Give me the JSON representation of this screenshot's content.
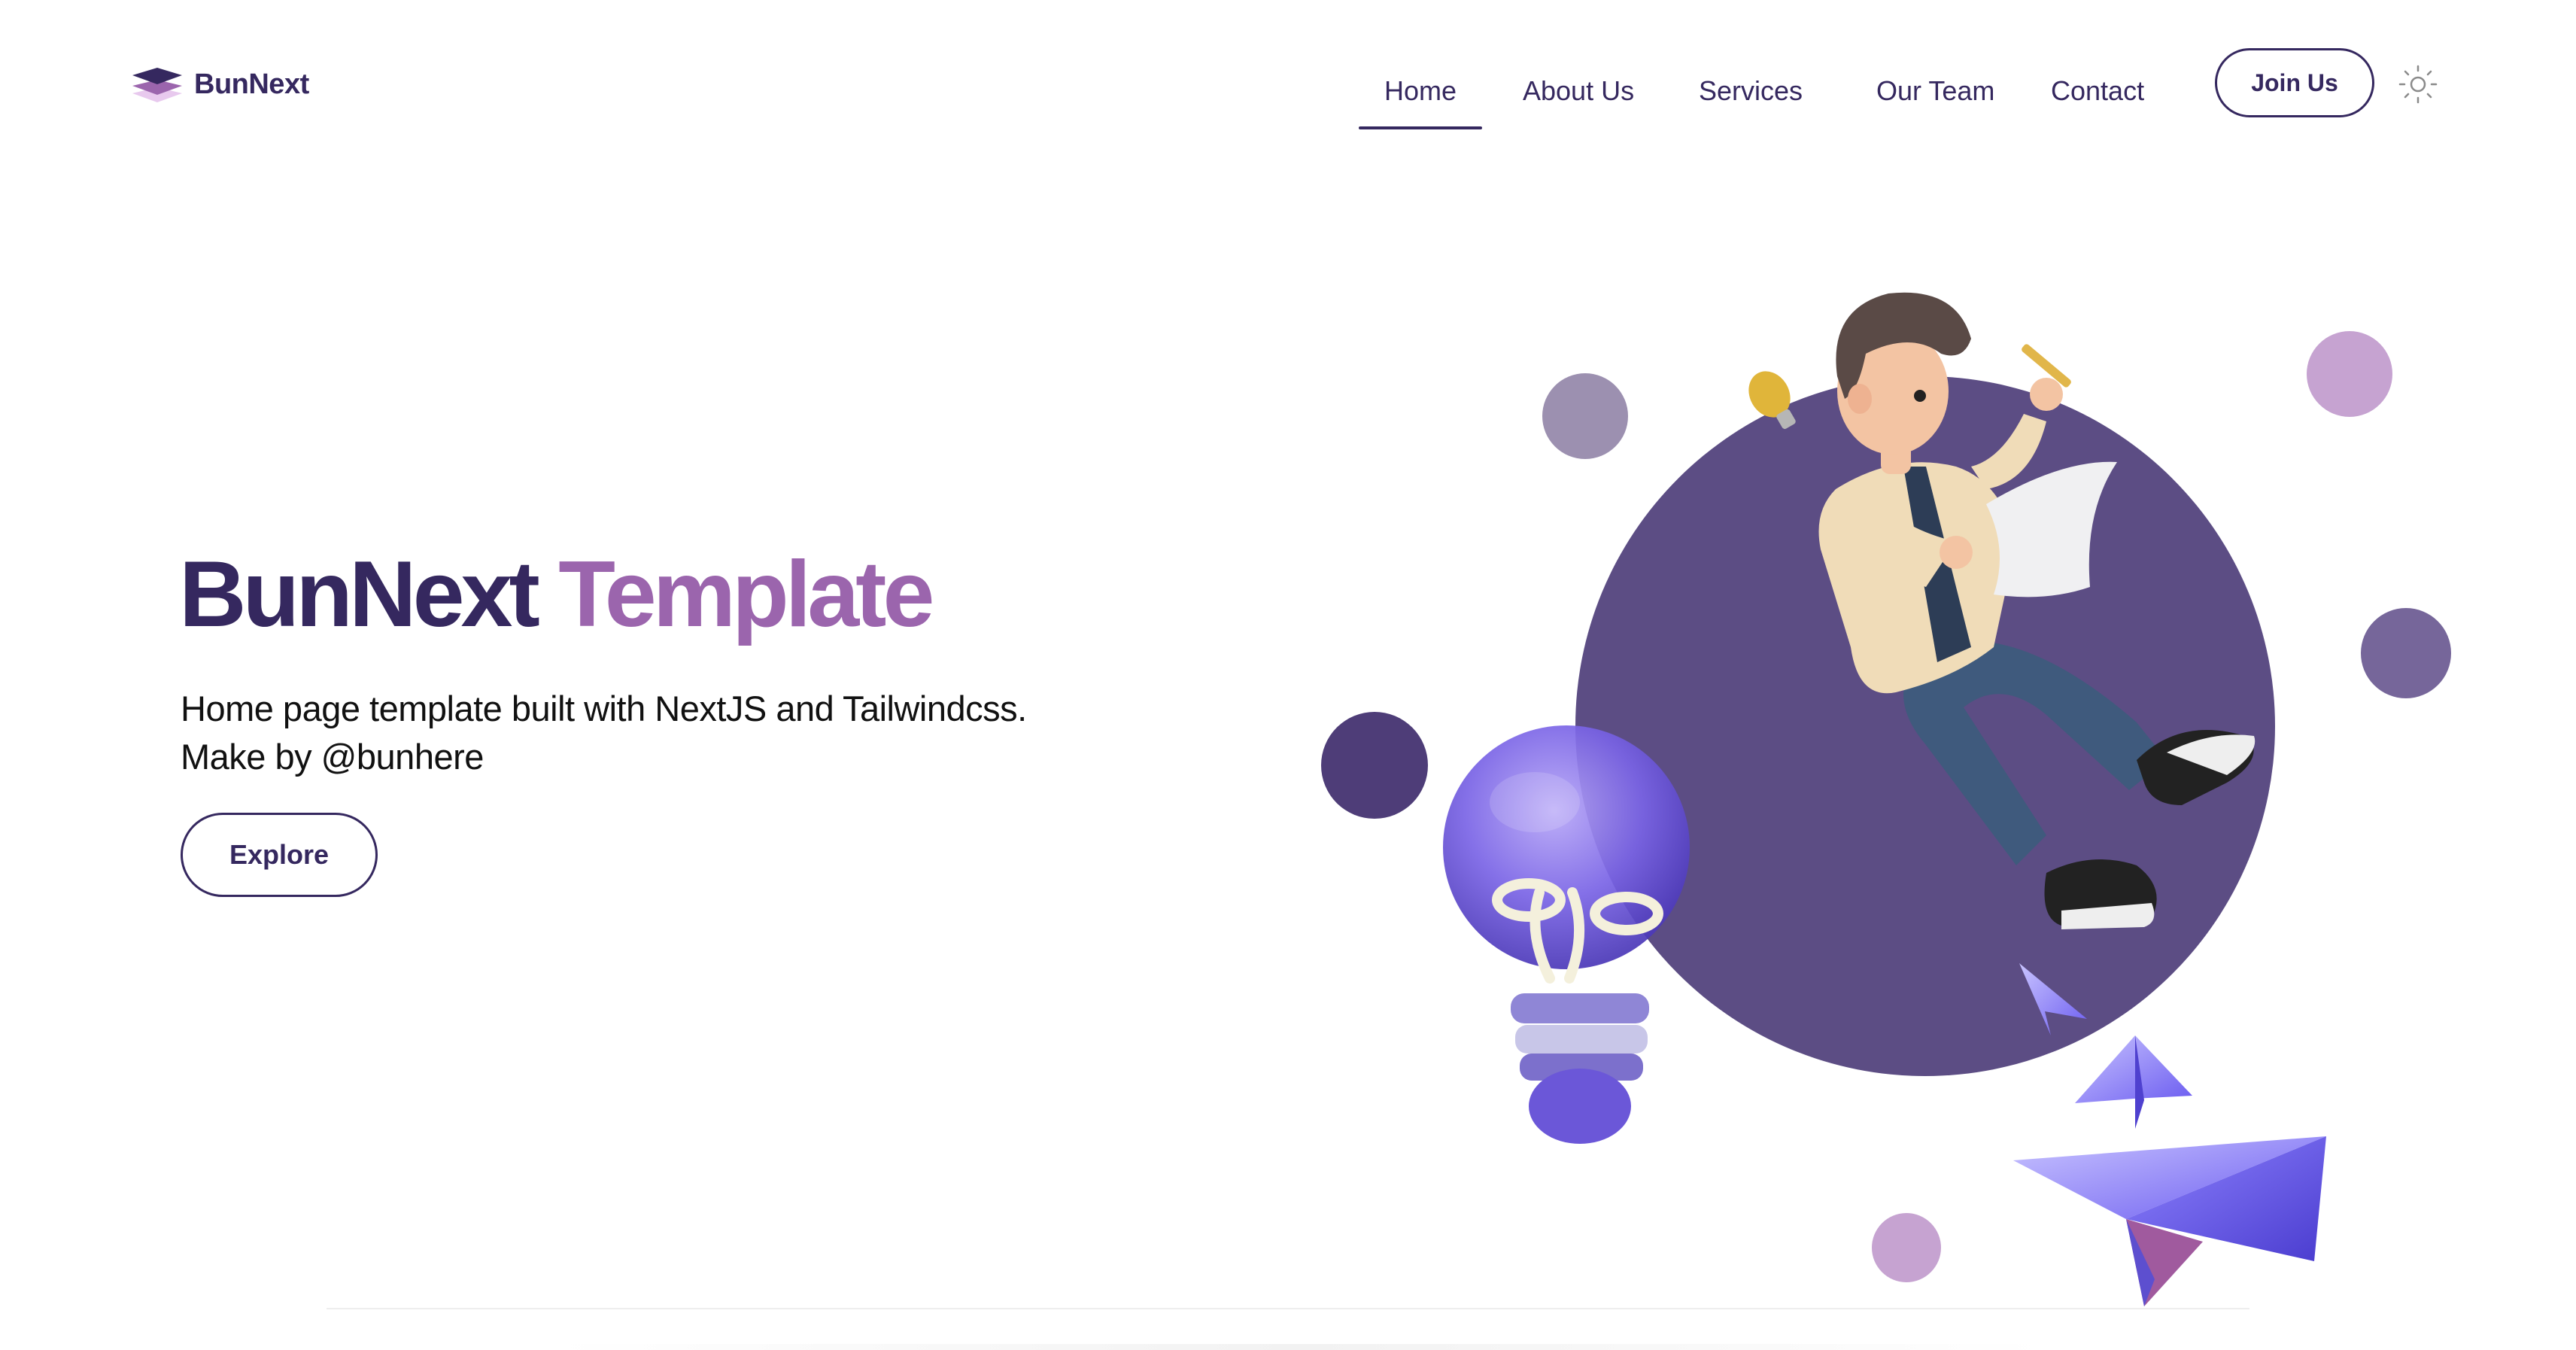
{
  "brand": {
    "name": "BunNext",
    "icon": "stacked-layers-icon"
  },
  "nav": {
    "items": [
      {
        "label": "Home",
        "active": true
      },
      {
        "label": "About Us",
        "active": false
      },
      {
        "label": "Services",
        "active": false
      },
      {
        "label": "Our Team",
        "active": false
      },
      {
        "label": "Contact",
        "active": false
      }
    ],
    "join_label": "Join Us",
    "theme_icon": "sun-icon"
  },
  "hero": {
    "title_part1": "BunNext",
    "title_part2": "Template",
    "subtitle_line1": "Home page template built with NextJS and Tailwindcss.",
    "subtitle_line2": "Make by @bunhere",
    "cta_label": "Explore"
  },
  "colors": {
    "primary": "#35285f",
    "accent": "#9b65ad",
    "circle": "#5c4d84",
    "dot_grey": "#9c90b0",
    "dot_lilac": "#c6a3d1",
    "dot_dark": "#4e3d78",
    "dot_mid": "#76669a"
  }
}
